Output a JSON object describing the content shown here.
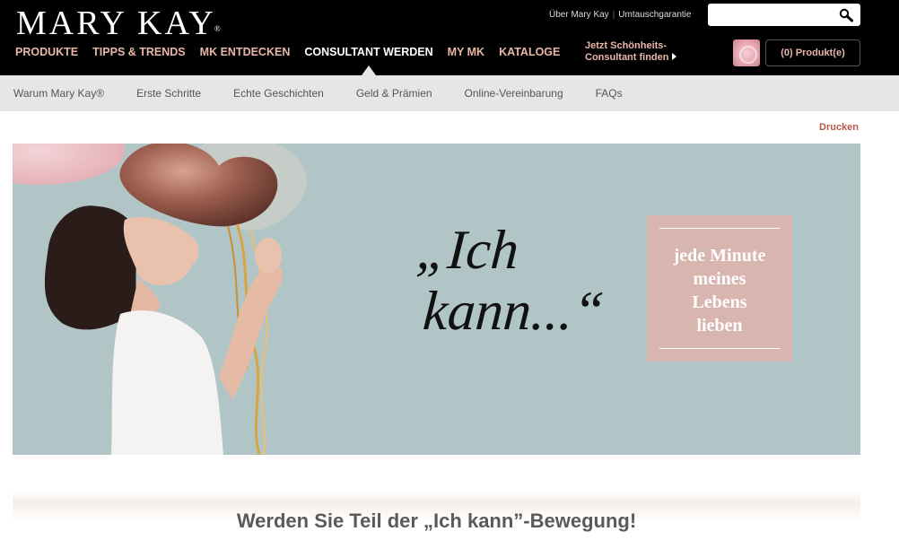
{
  "brand": {
    "logo": "MARY KAY",
    "logo_mark": "®"
  },
  "util_links": {
    "about": "Über Mary Kay",
    "separator": "|",
    "exchange": "Umtauschgarantie"
  },
  "search": {
    "value": "",
    "placeholder": ""
  },
  "main_nav": [
    {
      "label": "PRODUKTE"
    },
    {
      "label": "TIPPS & TRENDS"
    },
    {
      "label": "MK ENTDECKEN"
    },
    {
      "label": "CONSULTANT WERDEN",
      "active": true
    },
    {
      "label": "MY MK"
    },
    {
      "label": "KATALOGE"
    }
  ],
  "consultant_cta": {
    "line1": "Jetzt Schönheits-",
    "line2": "Consultant finden"
  },
  "cart": {
    "label": "(0) Produkt(e)"
  },
  "sub_nav": [
    {
      "label": "Warum Mary Kay®"
    },
    {
      "label": "Erste Schritte"
    },
    {
      "label": "Echte Geschichten"
    },
    {
      "label": "Geld & Prämien"
    },
    {
      "label": "Online-Vereinbarung"
    },
    {
      "label": "FAQs"
    }
  ],
  "print": {
    "label": "Drucken"
  },
  "hero": {
    "quote_line1": "„Ich",
    "quote_line2": "kann...“",
    "box_lines": [
      "jede Minute",
      "meines",
      "Lebens",
      "lieben"
    ]
  },
  "headline": "Werden Sie Teil der „Ich kann”-Bewegung!",
  "colors": {
    "header_bg": "#000000",
    "nav_accent": "#e8b7a7",
    "subnav_bg": "#e6e6e6",
    "hero_bg": "#b2c5c6",
    "quote_box": "#d8b5ae",
    "print_link": "#b3584a"
  },
  "icons": {
    "search": "magnifier-icon",
    "cart_thumb": "rose-icon",
    "cta_arrow": "triangle-right-icon"
  }
}
